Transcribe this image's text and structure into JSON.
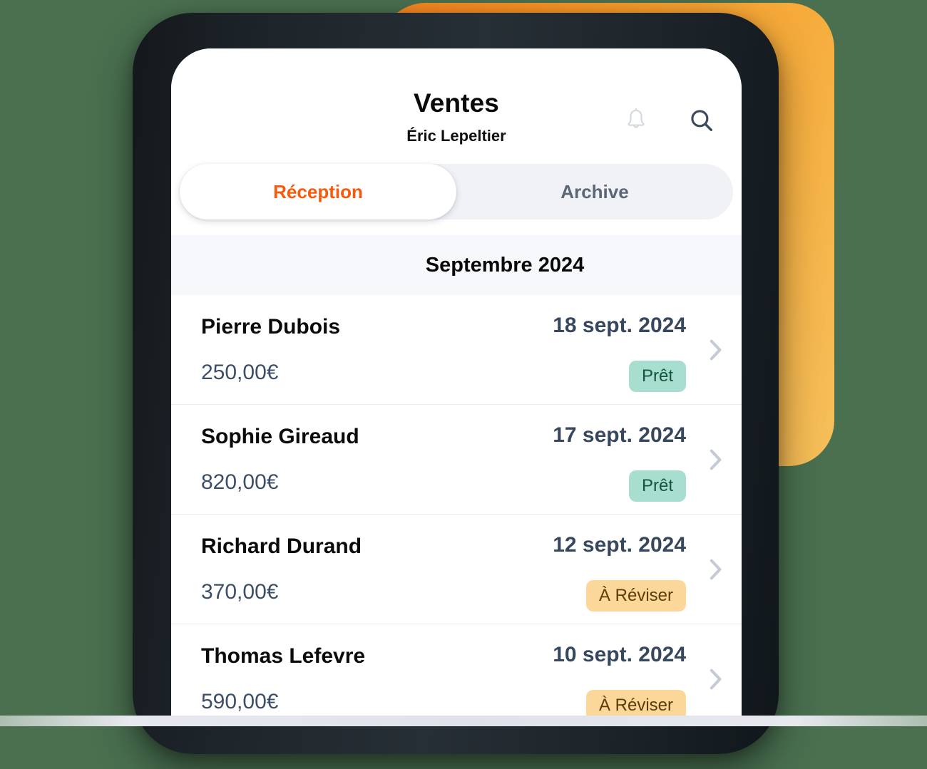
{
  "theme": {
    "accent_orange": "#f85a0d",
    "decor_gradient_start": "#f7841f",
    "decor_gradient_end": "#f6c05b",
    "badge_ready_bg": "#a8ded0",
    "badge_ready_text": "#13543f",
    "badge_review_bg": "#fbd89a",
    "badge_review_text": "#5a3d07",
    "date_text": "#37475e",
    "amount_text": "#3d4f66",
    "chevron": "#c5cbd6"
  },
  "header": {
    "title": "Ventes",
    "subtitle": "Éric Lepeltier",
    "actions": [
      {
        "name": "bell-icon",
        "label": "Notifications"
      },
      {
        "name": "search-icon",
        "label": "Rechercher"
      }
    ]
  },
  "tabs": [
    {
      "label": "Réception",
      "active": true
    },
    {
      "label": "Archive",
      "active": false
    }
  ],
  "month_header": "Septembre 2024",
  "transactions": [
    {
      "name": "Pierre Dubois",
      "amount": "250,00€",
      "date": "18 sept. 2024",
      "status": "Prêt",
      "status_type": "ready"
    },
    {
      "name": "Sophie Gireaud",
      "amount": "820,00€",
      "date": "17 sept. 2024",
      "status": "Prêt",
      "status_type": "ready"
    },
    {
      "name": "Richard Durand",
      "amount": "370,00€",
      "date": "12 sept. 2024",
      "status": "À Réviser",
      "status_type": "review"
    },
    {
      "name": "Thomas Lefevre",
      "amount": "590,00€",
      "date": "10 sept. 2024",
      "status": "À Réviser",
      "status_type": "review"
    }
  ]
}
